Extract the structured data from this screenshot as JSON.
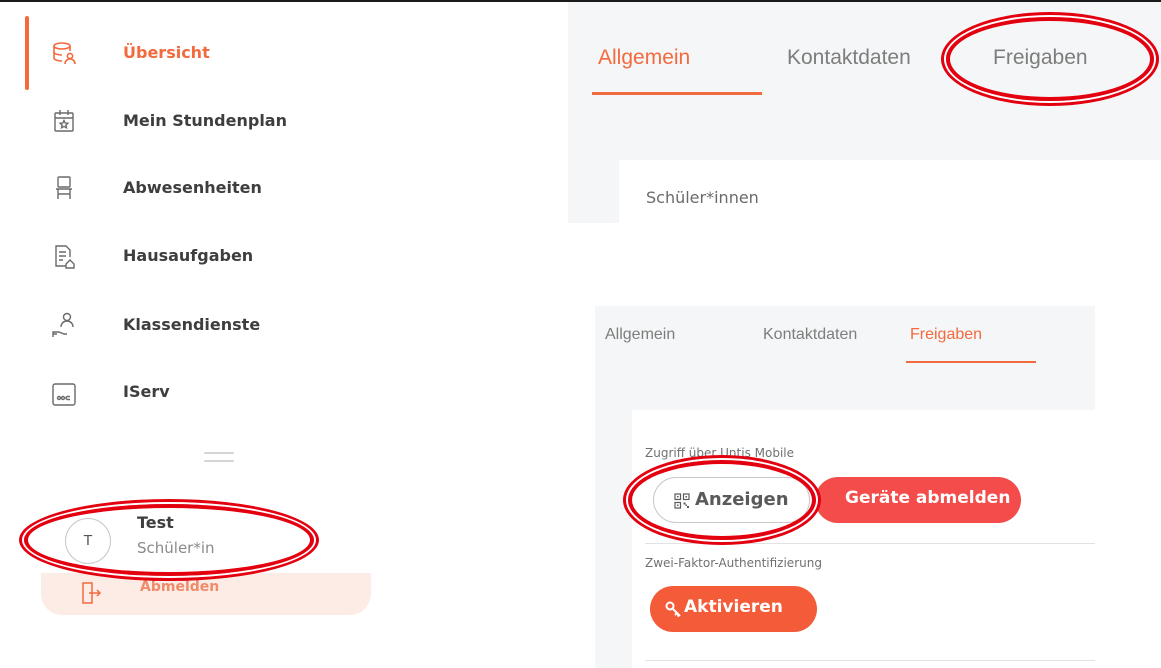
{
  "sidebar": {
    "items": [
      {
        "label": "Übersicht",
        "icon": "overview-icon",
        "active": true
      },
      {
        "label": "Mein Stundenplan",
        "icon": "calendar-icon",
        "active": false
      },
      {
        "label": "Abwesenheiten",
        "icon": "chair-icon",
        "active": false
      },
      {
        "label": "Hausaufgaben",
        "icon": "homework-icon",
        "active": false
      },
      {
        "label": "Klassendienste",
        "icon": "class-duty-icon",
        "active": false
      },
      {
        "label": "IServ",
        "icon": "iserv-icon",
        "active": false
      }
    ],
    "user": {
      "initial": "T",
      "name": "Test",
      "role": "Schüler*in"
    },
    "logout_label": "Abmelden"
  },
  "panel_top": {
    "tabs": [
      {
        "label": "Allgemein",
        "active": true
      },
      {
        "label": "Kontaktdaten",
        "active": false
      },
      {
        "label": "Freigaben",
        "active": false
      }
    ],
    "card_label": "Schüler*innen"
  },
  "panel_bottom": {
    "tabs": [
      {
        "label": "Allgemein",
        "active": false
      },
      {
        "label": "Kontaktdaten",
        "active": false
      },
      {
        "label": "Freigaben",
        "active": true
      }
    ],
    "section1_label": "Zugriff über Untis Mobile",
    "show_button": "Anzeigen",
    "logout_devices_button": "Geräte abmelden",
    "section2_label": "Zwei-Faktor-Authentifizierung",
    "activate_button": "Aktivieren"
  },
  "colors": {
    "accent": "#f26a3d",
    "danger": "#f44b4b",
    "activate": "#f45b39",
    "highlight": "#e3000f"
  }
}
